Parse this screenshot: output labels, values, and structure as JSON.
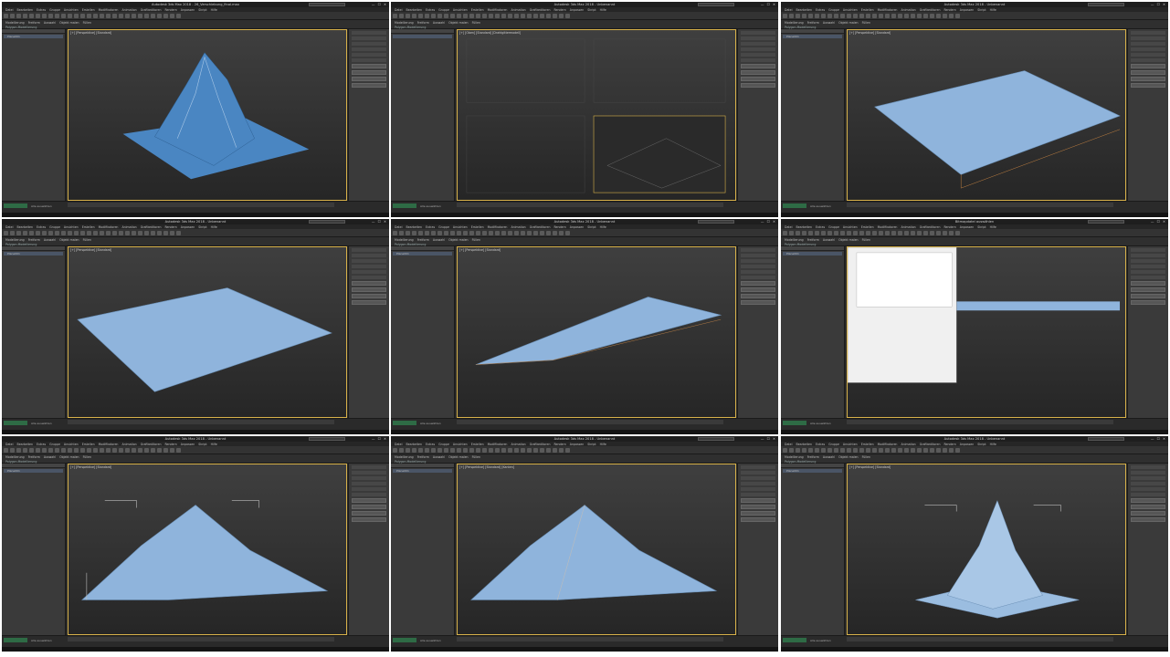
{
  "tiles": [
    {
      "title": "Autodesk 3ds Max 2018 - 26_Verschiebung_final.max",
      "viewport_label": "[+] [Perspektive] [Standard]",
      "status": "Alle auswählen",
      "scene_label": "Plane001"
    },
    {
      "title": "Autodesk 3ds Max 2018 - Unbenannt",
      "viewport_label": "[+] [Oben] [Standard] [Drahtgittermodell]",
      "status": "Alle auswählen",
      "scene_label": ""
    },
    {
      "title": "Autodesk 3ds Max 2018 - Unbenannt",
      "viewport_label": "[+] [Perspektive] [Standard]",
      "status": "Alle auswählen",
      "scene_label": "Plane001"
    },
    {
      "title": "Autodesk 3ds Max 2018 - Unbenannt",
      "viewport_label": "[+] [Perspektive] [Standard]",
      "status": "Alle auswählen",
      "scene_label": "Plane001"
    },
    {
      "title": "Autodesk 3ds Max 2018 - Unbenannt",
      "viewport_label": "[+] [Perspektive] [Standard]",
      "status": "Alle auswählen",
      "scene_label": "Plane001"
    },
    {
      "title": "Bitmapdatei auswählen",
      "viewport_label": "[+] [Perspektive] [Standard]",
      "status": "Alle auswählen",
      "scene_label": "Plane001"
    },
    {
      "title": "Autodesk 3ds Max 2018 - Unbenannt",
      "viewport_label": "[+] [Perspektive] [Standard]",
      "status": "Alle auswählen",
      "scene_label": "Plane001"
    },
    {
      "title": "Autodesk 3ds Max 2018 - Unbenannt",
      "viewport_label": "[+] [Perspektive] [Standard] [Kanten]",
      "status": "Alle auswählen",
      "scene_label": "Plane001"
    },
    {
      "title": "Autodesk 3ds Max 2018 - Unbenannt",
      "viewport_label": "[+] [Perspektive] [Standard]",
      "status": "Alle auswählen",
      "scene_label": "Plane001"
    }
  ],
  "menu": [
    "Datei",
    "Bearbeiten",
    "Extras",
    "Gruppe",
    "Ansichten",
    "Erstellen",
    "Modifikatoren",
    "Animation",
    "Grafikeditoren",
    "Rendern",
    "Anpassen",
    "Skript",
    "Hilfe"
  ],
  "ribbon": {
    "tabs": [
      "Modellierung",
      "Freiform",
      "Auswahl",
      "Objekt malen",
      "Füllen"
    ],
    "sub": "Polygon-Modellierung"
  },
  "colors": {
    "ui_bg": "#2b2b2b",
    "surface": "#8fb4dc",
    "surface_dark": "#4a86c2",
    "viewport_border": "#d8b24a"
  }
}
